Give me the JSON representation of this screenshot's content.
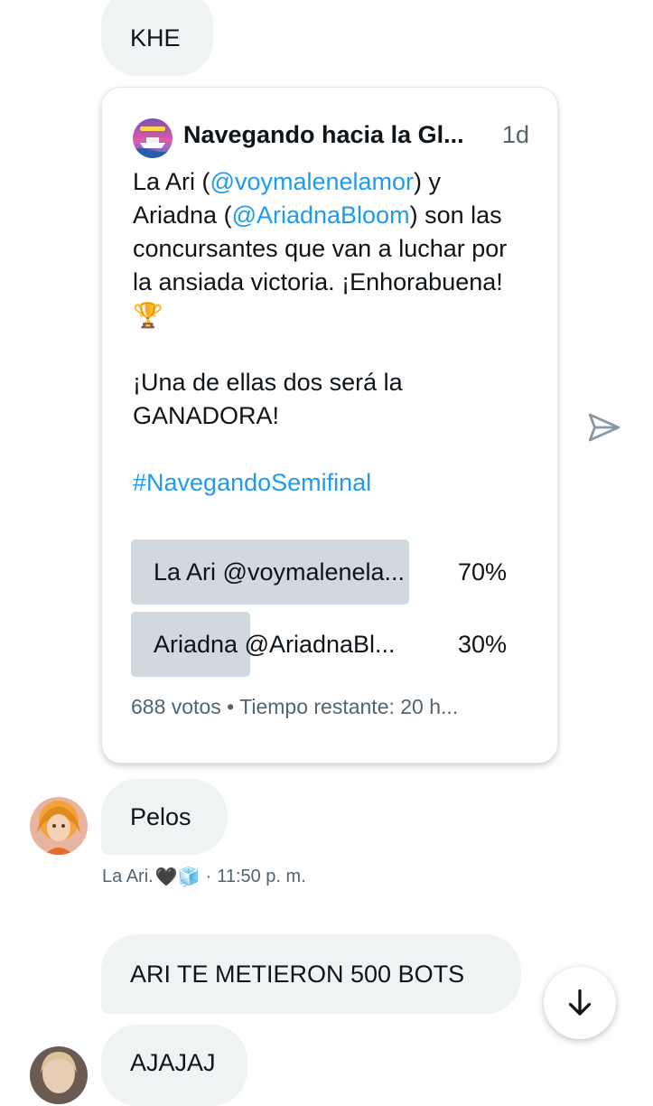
{
  "messages": {
    "khe": "KHE",
    "pelos": "Pelos",
    "bots": "ARI TE METIERON 500 BOTS",
    "ajajaj": "AJAJAJ"
  },
  "quoted_post": {
    "author_name": "Navegando hacia la Gl...",
    "time": "1d",
    "text_part1": "La Ari (",
    "mention1": "@voymalenelamor",
    "text_part2": ") y Ariadna (",
    "mention2": "@AriadnaBloom",
    "text_part3": ") son las concursantes que van a luchar por la ansiada victoria. ¡Enhorabuena! ",
    "trophy_emoji": "🏆",
    "text_part4": "¡Una de ellas dos será la GANADORA!",
    "hashtag": "#NavegandoSemifinal",
    "poll": {
      "options": [
        {
          "label": "La Ari @voymalenela...",
          "percent_label": "70%",
          "share": 0.7
        },
        {
          "label": "Ariadna @AriadnaBl...",
          "percent_label": "30%",
          "share": 0.3
        }
      ],
      "meta": "688 votos • Tiempo restante: 20 h..."
    }
  },
  "message_meta": {
    "sender": "La Ari.",
    "emojis": "🖤🧊",
    "separator": "·",
    "time": "11:50 p. m."
  },
  "icons": {
    "share": "paper-plane-icon",
    "scroll": "arrow-down-icon"
  },
  "colors": {
    "link": "#1d9bf0",
    "bubble": "#eff3f4",
    "poll_fill": "#cfd9de",
    "muted_text": "#536471"
  }
}
